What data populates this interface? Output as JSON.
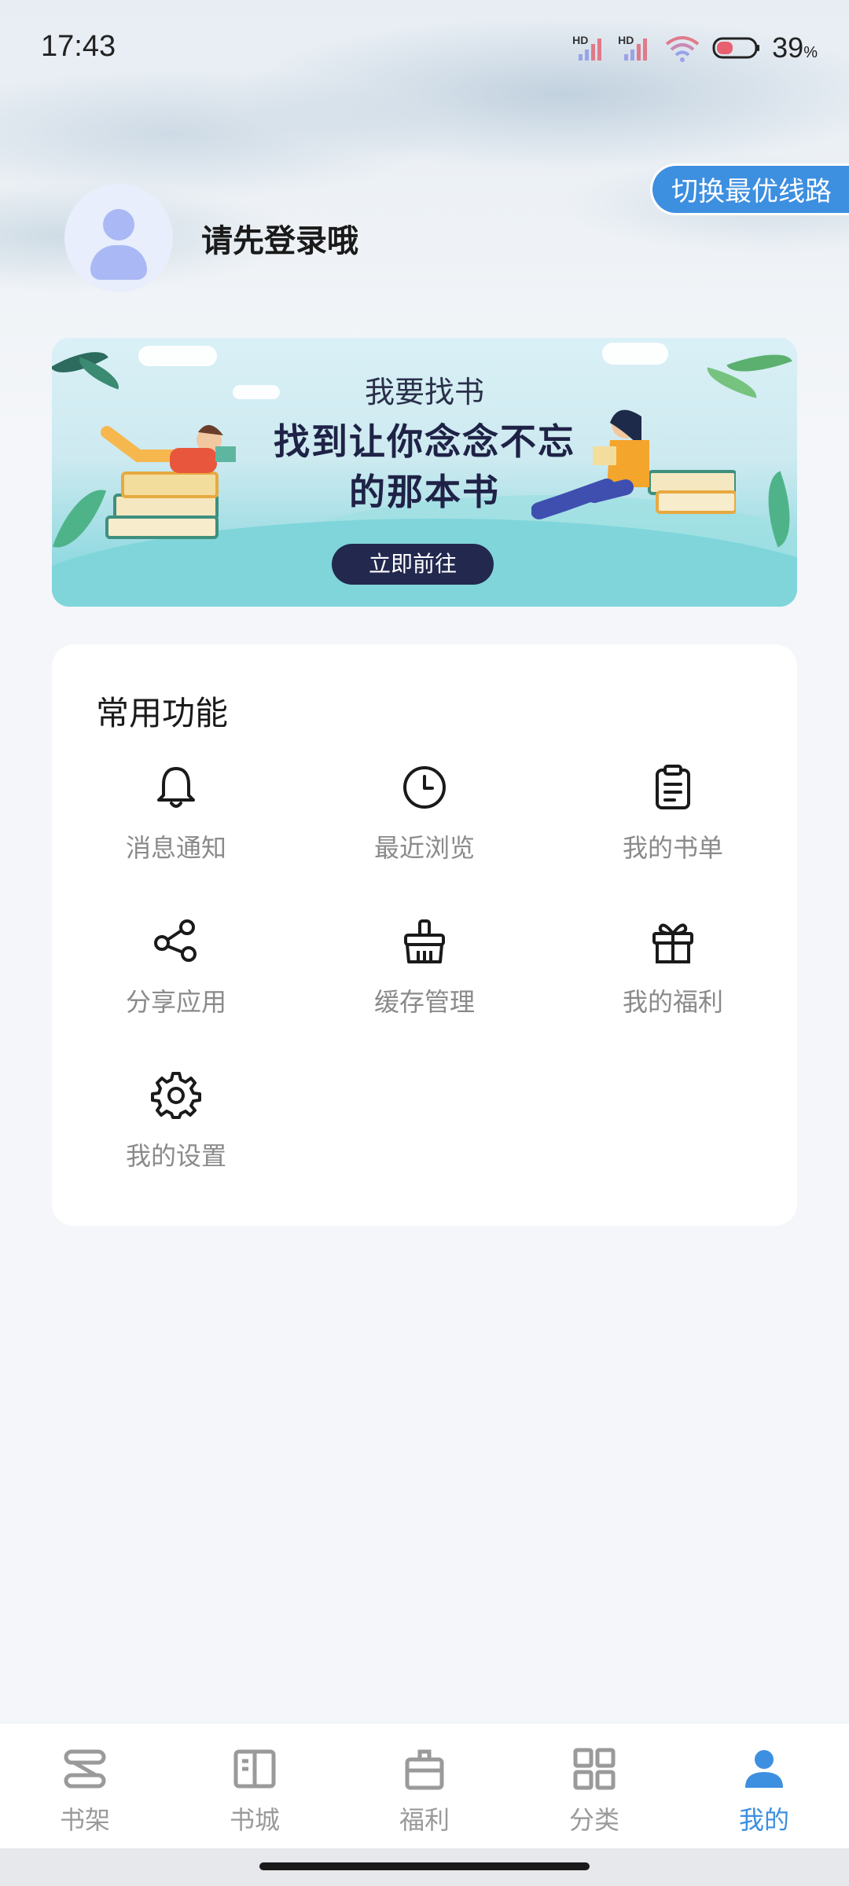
{
  "status_bar": {
    "time": "17:43",
    "sim1_label": "HD",
    "sim2_label": "HD",
    "battery_percent": "39",
    "battery_unit": "%"
  },
  "header": {
    "line_switch_label": "切换最优线路",
    "login_prompt": "请先登录哦"
  },
  "banner": {
    "subtitle": "我要找书",
    "headline_line1": "找到让你念念不忘",
    "headline_line2": "的那本书",
    "button_label": "立即前往"
  },
  "functions": {
    "title": "常用功能",
    "items": [
      {
        "label": "消息通知",
        "icon": "bell-icon"
      },
      {
        "label": "最近浏览",
        "icon": "clock-icon"
      },
      {
        "label": "我的书单",
        "icon": "clipboard-icon"
      },
      {
        "label": "分享应用",
        "icon": "share-icon"
      },
      {
        "label": "缓存管理",
        "icon": "broom-icon"
      },
      {
        "label": "我的福利",
        "icon": "gift-icon"
      },
      {
        "label": "我的设置",
        "icon": "gear-icon"
      }
    ]
  },
  "bottom_nav": {
    "items": [
      {
        "label": "书架",
        "icon": "bookshelf-icon"
      },
      {
        "label": "书城",
        "icon": "book-open-icon"
      },
      {
        "label": "福利",
        "icon": "gift-bag-icon"
      },
      {
        "label": "分类",
        "icon": "grid-icon"
      },
      {
        "label": "我的",
        "icon": "person-icon",
        "active": true
      }
    ]
  },
  "colors": {
    "accent": "#3d8fe0",
    "banner_button": "#23284f",
    "label_gray": "#8a8a8a"
  }
}
